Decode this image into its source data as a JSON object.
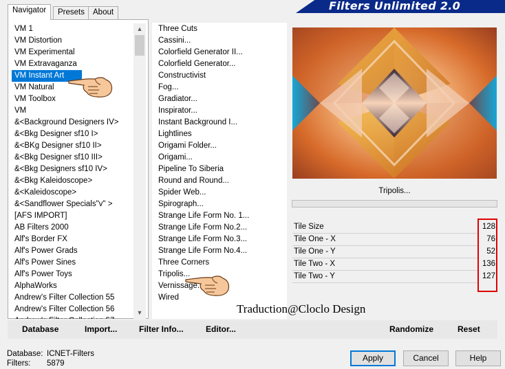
{
  "title": "Filters Unlimited 2.0",
  "tabs": [
    {
      "label": "Navigator",
      "active": true
    },
    {
      "label": "Presets",
      "active": false
    },
    {
      "label": "About",
      "active": false
    }
  ],
  "categories": {
    "selected_index": 3,
    "items": [
      "VM 1",
      "VM Distortion",
      "VM Experimental",
      "VM Extravaganza",
      "VM Instant Art",
      "VM Natural",
      "VM Toolbox",
      "VM",
      "&<Background Designers IV>",
      "&<Bkg Designer sf10 I>",
      "&<BKg Designer sf10 II>",
      "&<Bkg Designer sf10 III>",
      "&<Bkg Designers sf10 IV>",
      "&<Bkg Kaleidoscope>",
      "&<Kaleidoscope>",
      "&<Sandflower Specials\"v\" >",
      "[AFS IMPORT]",
      "AB Filters 2000",
      "Alf's Border FX",
      "Alf's Power Grads",
      "Alf's Power Sines",
      "Alf's Power Toys",
      "AlphaWorks",
      "Andrew's Filter Collection 55",
      "Andrew's Filter Collection 56",
      "Andrew's Filter Collection 57"
    ]
  },
  "filters": {
    "items": [
      "Three Cuts",
      "Cassini...",
      "Colorfield Generator II...",
      "Colorfield Generator...",
      "Constructivist",
      "Fog...",
      "Gradiator...",
      "Inspirator...",
      "Instant Background I...",
      "Lightlines",
      "Origami Folder...",
      "Origami...",
      "Pipeline To Siberia",
      "Round and Round...",
      "Spider Web...",
      "Spirograph...",
      "Strange Life Form No. 1...",
      "Strange Life Form No.2...",
      "Strange Life Form No.3...",
      "Strange Life Form No.4...",
      "Three Corners",
      "Tripolis...",
      "Vernissage...",
      "Wired"
    ]
  },
  "current_filter": "Tripolis...",
  "params": [
    {
      "label": "Tile Size",
      "value": "128"
    },
    {
      "label": "Tile One - X",
      "value": "76"
    },
    {
      "label": "Tile One - Y",
      "value": "52"
    },
    {
      "label": "Tile Two - X",
      "value": "136"
    },
    {
      "label": "Tile Two - Y",
      "value": "127"
    }
  ],
  "strip_buttons": {
    "database": "Database",
    "import": "Import...",
    "filter_info": "Filter Info...",
    "editor": "Editor...",
    "randomize": "Randomize",
    "reset": "Reset"
  },
  "info": {
    "database_label": "Database:",
    "database_value": "ICNET-Filters",
    "filters_label": "Filters:",
    "filters_value": "5879"
  },
  "buttons": {
    "apply": "Apply",
    "cancel": "Cancel",
    "help": "Help"
  },
  "credit": "Traduction@Cloclo Design",
  "colors": {
    "accent": "#0078d7",
    "banner": "#0a2a8a",
    "highlight": "#e00000"
  }
}
